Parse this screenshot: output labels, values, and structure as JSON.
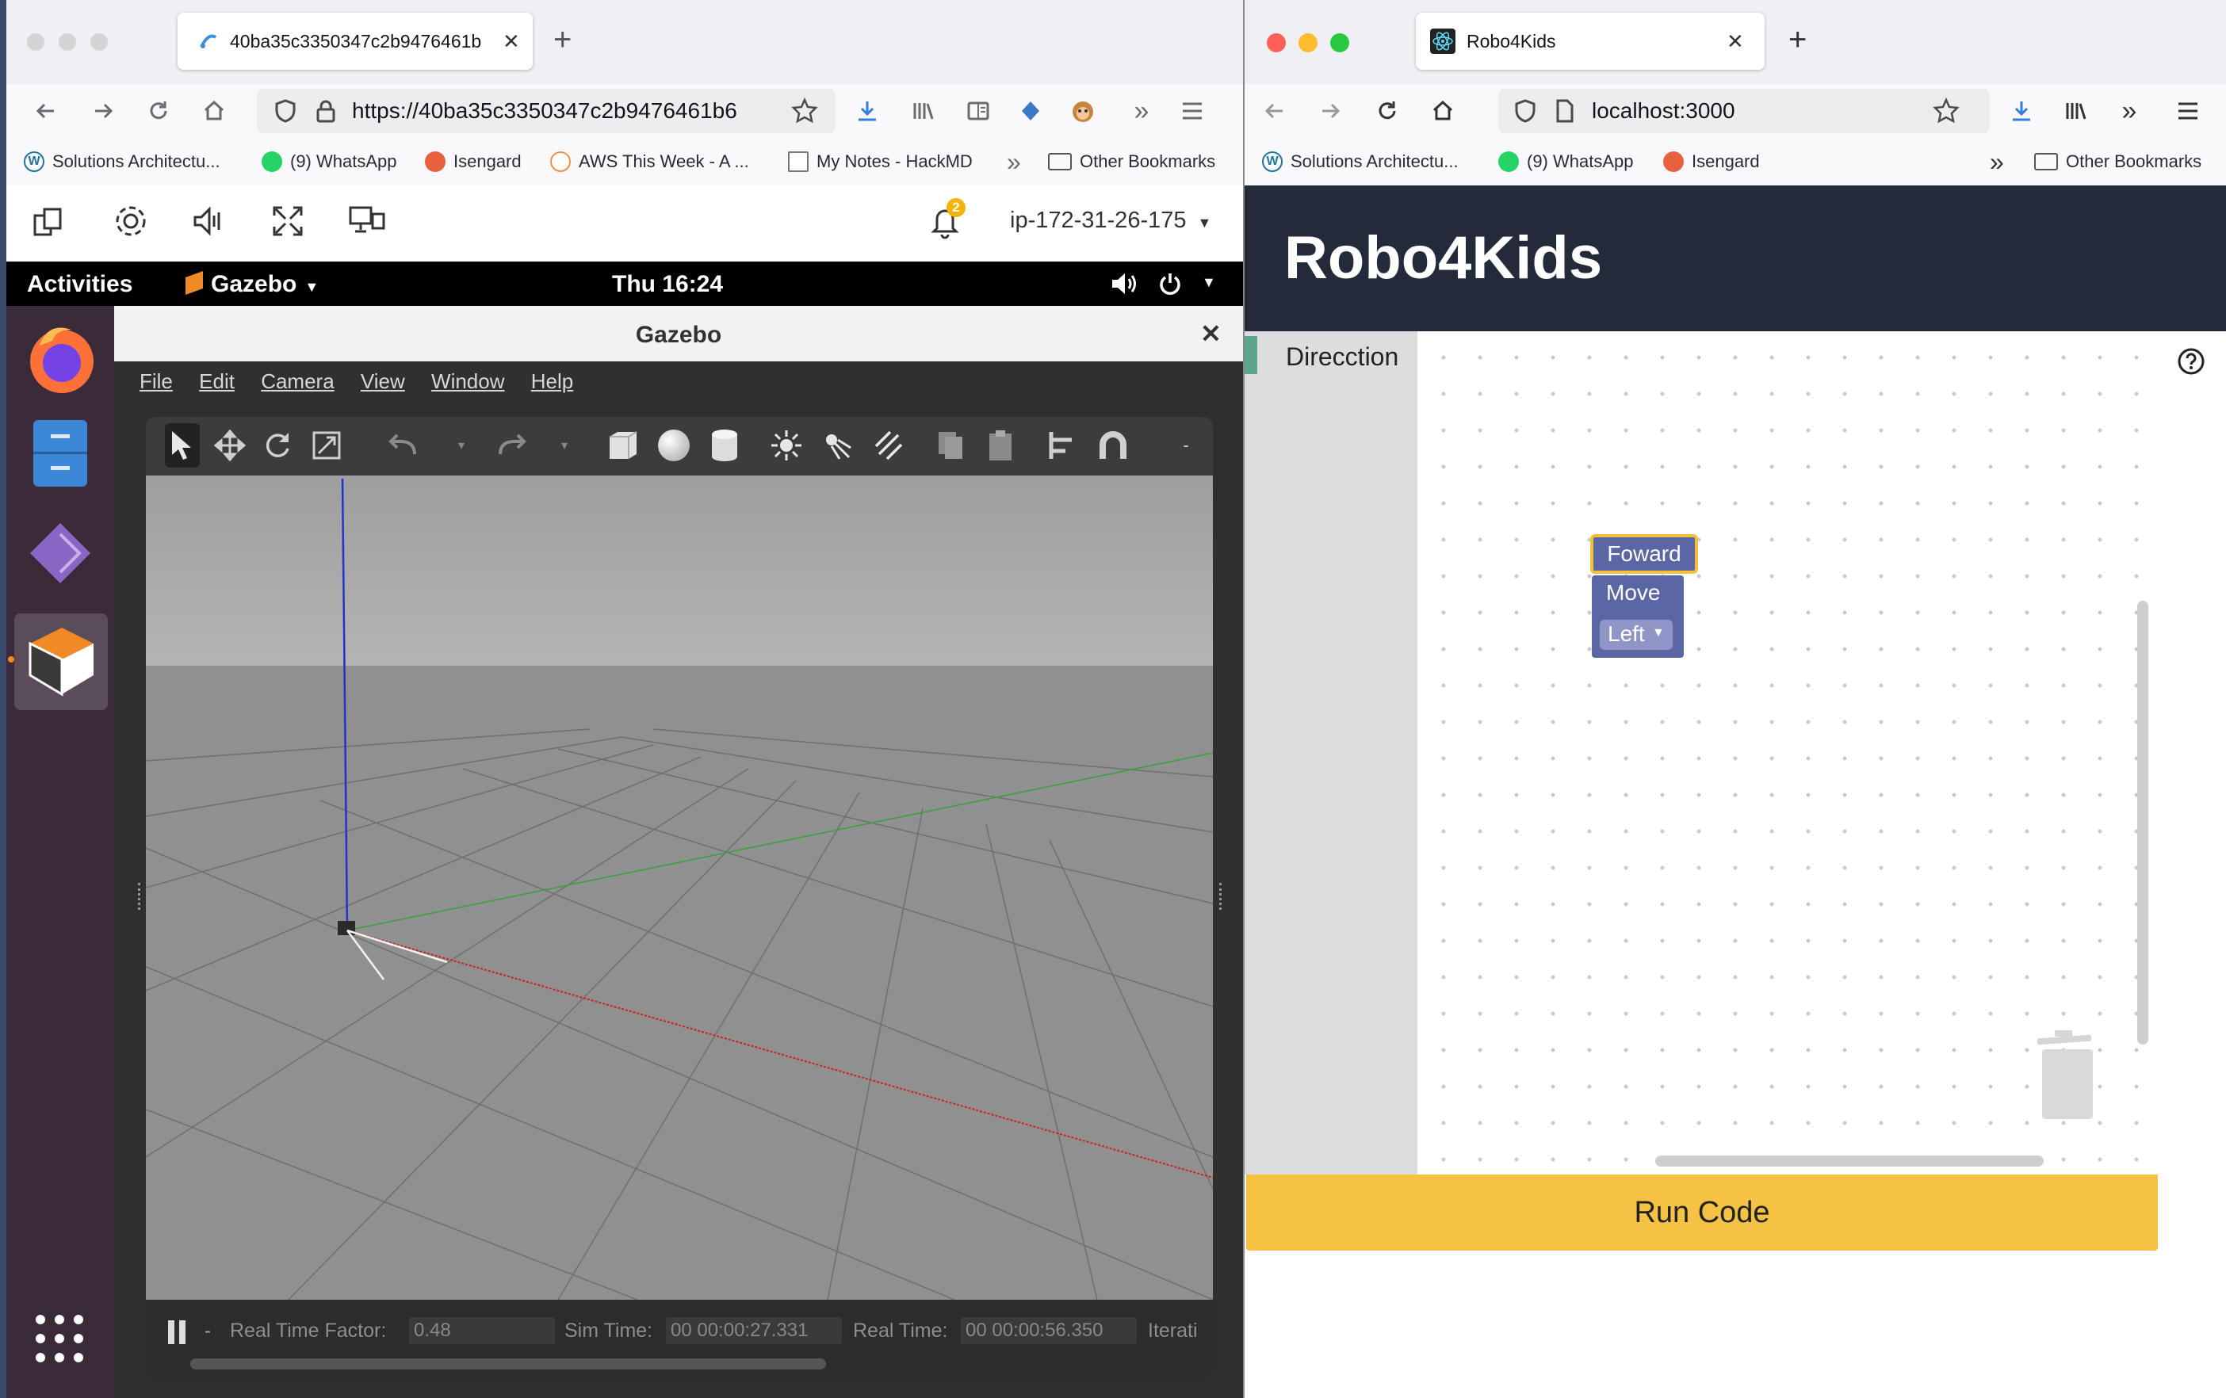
{
  "left_browser": {
    "tab_title": "40ba35c3350347c2b9476461b",
    "url": "https://40ba35c3350347c2b9476461b6",
    "bookmarks": [
      "Solutions Architectu...",
      "(9) WhatsApp",
      "Isengard",
      "AWS This Week - A ...",
      "My Notes - HackMD"
    ],
    "other_bookmarks": "Other Bookmarks",
    "dcv_toolbar": {
      "notification_count": "2",
      "host": "ip-172-31-26-175"
    }
  },
  "ubuntu": {
    "activities": "Activities",
    "app_menu": "Gazebo",
    "clock": "Thu 16:24"
  },
  "gazebo": {
    "title": "Gazebo",
    "menu": [
      "File",
      "Edit",
      "Camera",
      "View",
      "Window",
      "Help"
    ],
    "status": {
      "rtf_label": "Real Time Factor:",
      "rtf_value": "0.48",
      "sim_label": "Sim Time:",
      "sim_value": "00 00:00:27.331",
      "real_label": "Real Time:",
      "real_value": "00 00:00:56.350",
      "iter_label": "Iterati"
    }
  },
  "right_browser": {
    "tab_title": "Robo4Kids",
    "url": "localhost:3000",
    "bookmarks": [
      "Solutions Architectu...",
      "(9) WhatsApp",
      "Isengard"
    ],
    "other_bookmarks": "Other Bookmarks"
  },
  "app": {
    "title": "Robo4Kids",
    "category": "Direcction",
    "blocks": {
      "forward": "Foward",
      "move": "Move",
      "dropdown": "Left"
    },
    "run_button": "Run Code",
    "colors": {
      "header_bg": "#232b3b",
      "block": "#5b67a5",
      "selected_outline": "#f2c03b",
      "run_button": "#f5c244"
    }
  }
}
